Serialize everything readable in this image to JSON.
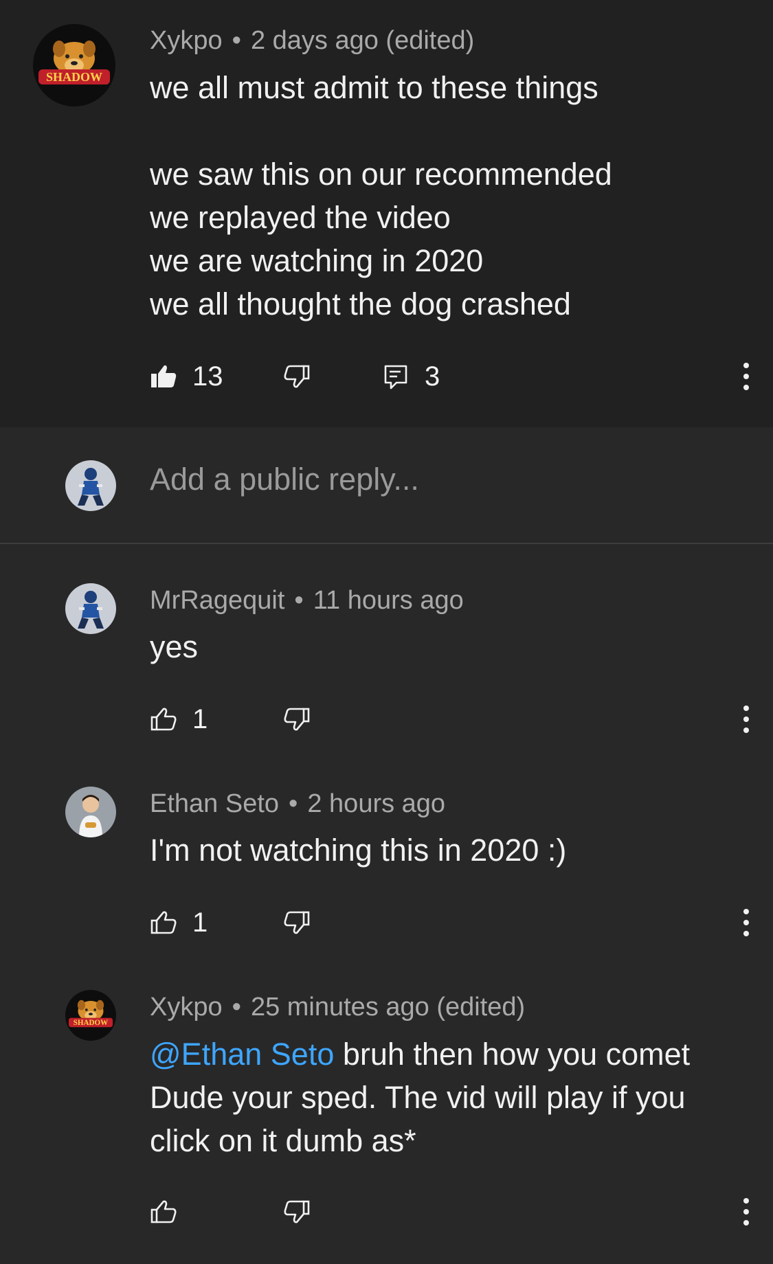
{
  "top_comment": {
    "author": "Xykpo",
    "time": "2 days ago (edited)",
    "text": "we all must admit to these things\n\nwe saw this on our recommended\nwe replayed the video\nwe are watching in 2020\nwe all thought the dog crashed",
    "likes": "13",
    "replies": "3",
    "liked": true,
    "avatar_badge": "SHADOW"
  },
  "reply_input": {
    "placeholder": "Add a public reply..."
  },
  "replies": [
    {
      "author": "MrRagequit",
      "time": "11 hours ago",
      "text": "yes",
      "likes": "1"
    },
    {
      "author": "Ethan Seto",
      "time": "2 hours ago",
      "text": "I'm not watching this in 2020 :)",
      "likes": "1"
    },
    {
      "author": "Xykpo",
      "time": "25 minutes ago (edited)",
      "mention": "@Ethan Seto",
      "text": " bruh then how you comet\nDude your sped. The vid will play if you\nclick on it dumb as*",
      "likes": "",
      "avatar_badge": "SHADOW"
    }
  ],
  "colors": {
    "top_background": "#212121",
    "background": "#282828",
    "mention": "#3ea6ff",
    "meta_text": "#aaaaaa"
  }
}
